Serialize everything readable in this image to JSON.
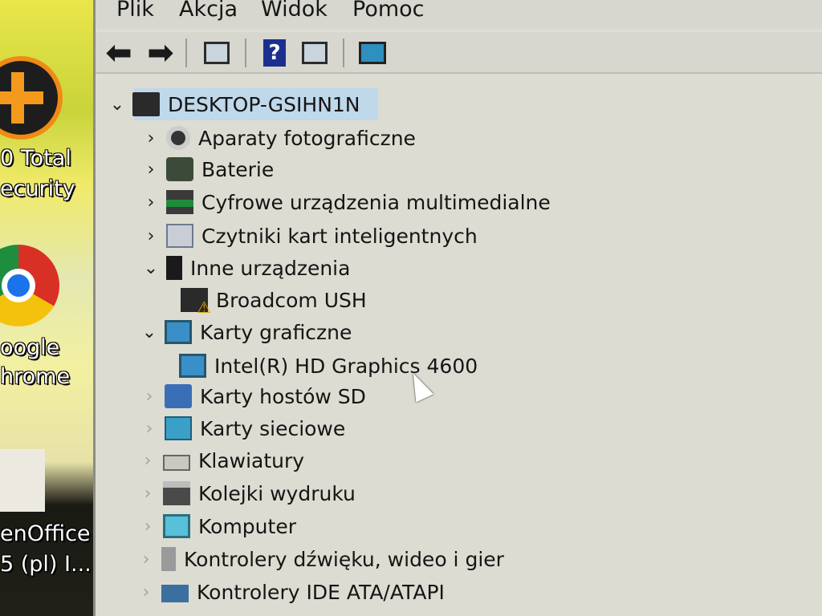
{
  "desktop": {
    "icons": [
      {
        "name": "total-security",
        "label_line1": "0 Total",
        "label_line2": "ecurity"
      },
      {
        "name": "google-chrome",
        "label_line1": "oogle",
        "label_line2": "hrome"
      },
      {
        "name": "openoffice",
        "label_line1": "enOffice",
        "label_line2": "5 (pl) I..."
      }
    ]
  },
  "window": {
    "menu": [
      "Plik",
      "Akcja",
      "Widok",
      "Pomoc"
    ],
    "toolbar_icons": [
      "back-arrow-icon",
      "forward-arrow-icon",
      "properties-icon",
      "help-icon",
      "view-icon",
      "scan-hardware-icon"
    ],
    "tree": {
      "root": "DESKTOP-GSIHN1N",
      "items": [
        {
          "label": "Aparaty fotograficzne",
          "icon": "camera-icon",
          "expanded": false
        },
        {
          "label": "Baterie",
          "icon": "battery-icon",
          "expanded": false
        },
        {
          "label": "Cyfrowe urządzenia multimedialne",
          "icon": "media-device-icon",
          "expanded": false
        },
        {
          "label": "Czytniki kart inteligentnych",
          "icon": "smart-card-icon",
          "expanded": false
        },
        {
          "label": "Inne urządzenia",
          "icon": "other-devices-icon",
          "expanded": true,
          "children": [
            "Broadcom USH"
          ]
        },
        {
          "label": "Karty graficzne",
          "icon": "display-adapter-icon",
          "expanded": true,
          "children": [
            "Intel(R) HD Graphics 4600"
          ]
        },
        {
          "label": "Karty hostów SD",
          "icon": "sd-host-icon",
          "expanded": false
        },
        {
          "label": "Karty sieciowe",
          "icon": "network-adapter-icon",
          "expanded": false
        },
        {
          "label": "Klawiatury",
          "icon": "keyboard-icon",
          "expanded": false
        },
        {
          "label": "Kolejki wydruku",
          "icon": "print-queue-icon",
          "expanded": false
        },
        {
          "label": "Komputer",
          "icon": "computer-icon",
          "expanded": false
        },
        {
          "label": "Kontrolery dźwięku, wideo i gier",
          "icon": "sound-controller-icon",
          "expanded": false
        },
        {
          "label": "Kontrolery IDE ATA/ATAPI",
          "icon": "ide-controller-icon",
          "expanded": false
        }
      ]
    }
  }
}
